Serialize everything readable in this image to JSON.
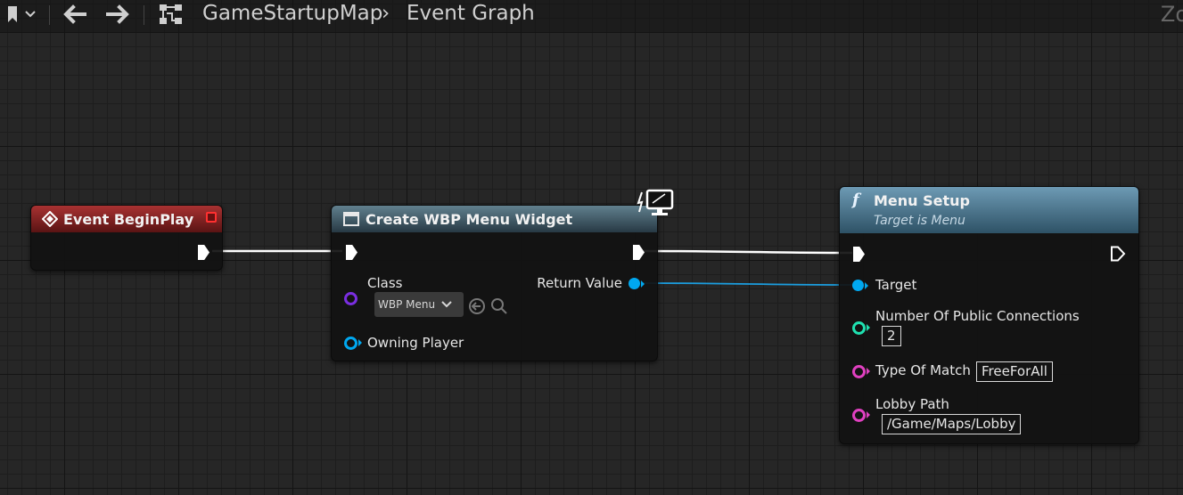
{
  "toolbar": {
    "bookmark_icon": "bookmark-icon",
    "back_icon": "arrow-left-icon",
    "forward_icon": "arrow-right-icon",
    "graph_icon": "hierarchy-icon",
    "breadcrumb": {
      "map": "GameStartupMap",
      "separator": "›",
      "graph": "Event Graph"
    },
    "corner_text": "Zo"
  },
  "colors": {
    "exec": "#ffffff",
    "object": "#00a8f0",
    "integer": "#1fe0b0",
    "string": "#e040c0",
    "class": "#7a2ee0",
    "event_header": "#a83232",
    "function_header": "#6d9ab4"
  },
  "nodes": {
    "begin_play": {
      "title": "Event BeginPlay"
    },
    "create_widget": {
      "title": "Create WBP Menu Widget",
      "class_label": "Class",
      "class_value": "WBP Menu",
      "return_label": "Return Value",
      "owning_label": "Owning Player"
    },
    "menu_setup": {
      "title": "Menu Setup",
      "subtitle": "Target is Menu",
      "func_glyph": "f",
      "target_label": "Target",
      "connections_label": "Number Of Public Connections",
      "connections_value": "2",
      "match_label": "Type Of Match",
      "match_value": "FreeForAll",
      "lobby_label": "Lobby Path",
      "lobby_value": "/Game/Maps/Lobby"
    }
  }
}
